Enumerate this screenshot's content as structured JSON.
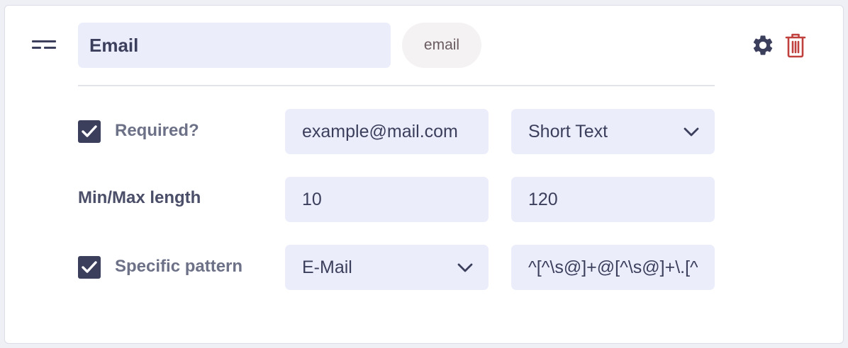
{
  "field": {
    "name_value": "Email",
    "slug": "email"
  },
  "options": {
    "required": {
      "label": "Required?",
      "checked": true
    },
    "placeholder_value": "example@mail.com",
    "type_select": {
      "selected": "Short Text"
    },
    "length": {
      "label": "Min/Max length",
      "min": "10",
      "max": "120"
    },
    "pattern": {
      "label": "Specific pattern",
      "checked": true,
      "preset_select": {
        "selected": "E-Mail"
      },
      "regex_value": "^[^\\s@]+@[^\\s@]+\\.[^\\s@]+$"
    }
  },
  "icons": [
    "drag-handle-icon",
    "gear-icon",
    "trash-icon",
    "check-icon",
    "chevron-down-icon"
  ],
  "colors": {
    "card": "#ffffff",
    "input_bg": "#ebedfb",
    "text_dark": "#3b3f5c",
    "muted_label": "#6d7187",
    "pill_bg": "#f5f2f3",
    "delete_red": "#c0403e"
  }
}
